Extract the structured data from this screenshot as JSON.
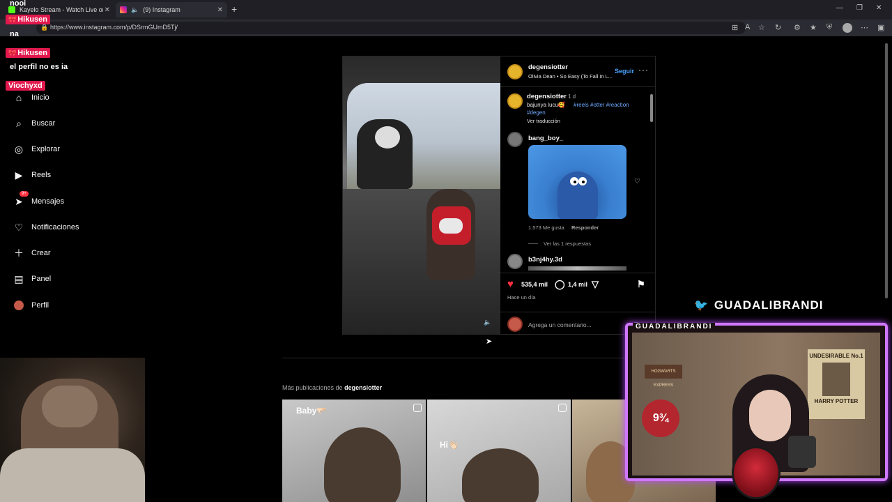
{
  "browser": {
    "tabs": [
      {
        "title": "Kayelo Stream - Watch Live on Ki",
        "active": false
      },
      {
        "title": "(9) Instagram",
        "active": true
      }
    ],
    "url": "https://www.instagram.com/p/DSrmGUmD5Tj/"
  },
  "overlay_chat": {
    "lines": [
      {
        "text": "nooi"
      },
      {
        "text": "na"
      },
      {
        "text": "el perfil no es ia"
      }
    ],
    "names": [
      "Hikusen",
      "Hikusen",
      "Viochyxd"
    ]
  },
  "sidebar": {
    "items": [
      {
        "label": "Inicio",
        "icon": "home-icon"
      },
      {
        "label": "Buscar",
        "icon": "search-icon"
      },
      {
        "label": "Explorar",
        "icon": "compass-icon"
      },
      {
        "label": "Reels",
        "icon": "reels-icon"
      },
      {
        "label": "Mensajes",
        "icon": "messenger-icon",
        "badge": "9+"
      },
      {
        "label": "Notificaciones",
        "icon": "heart-icon"
      },
      {
        "label": "Crear",
        "icon": "plus-icon"
      },
      {
        "label": "Panel",
        "icon": "chart-icon"
      },
      {
        "label": "Perfil",
        "icon": "profile-avatar-icon"
      }
    ]
  },
  "post": {
    "author": "degensiotter",
    "audio": "Olivia Dean • So Easy (To Fall In L...",
    "follow_label": "Seguir",
    "caption_author": "degensiotter",
    "caption_time": "1 d",
    "caption_text": "bajunya lucu🥰",
    "caption_tags": "#reels #otter #reaction",
    "caption_tag2": "#degen",
    "translate_label": "Ver traducción",
    "comments": [
      {
        "user": "bang_boy_",
        "likes": "1.573 Me gusta",
        "reply_label": "Responder",
        "view_replies": "Ver las 1 respuestas"
      },
      {
        "user": "b3nj4hy.3d"
      }
    ],
    "like_count": "535,4 mil",
    "comment_count": "1,4 mil",
    "time_ago": "Hace un día",
    "add_comment_placeholder": "Agrega un comentario..."
  },
  "more_posts": {
    "label_prefix": "Más publicaciones de",
    "label_user": "degensiotter",
    "thumbs": [
      {
        "caption": "Baby🫳🏻"
      },
      {
        "caption": "Hi👋🏻"
      },
      {
        "caption": ""
      }
    ]
  },
  "stream": {
    "twitter_handle": "GUADALIBRANDI",
    "cam_label": "GUADALIBRANDI",
    "poster_text": "UNDESIRABLE No.1",
    "poster_name": "HARRY POTTER",
    "platform_text": "9¾",
    "hogwarts_text": "HOGWARTS EXPRESS"
  },
  "colors": {
    "accent": "#4ba3ff",
    "like": "#ff3040",
    "chat_badge": "#e0194d",
    "cam_border": "#cf78ff"
  }
}
